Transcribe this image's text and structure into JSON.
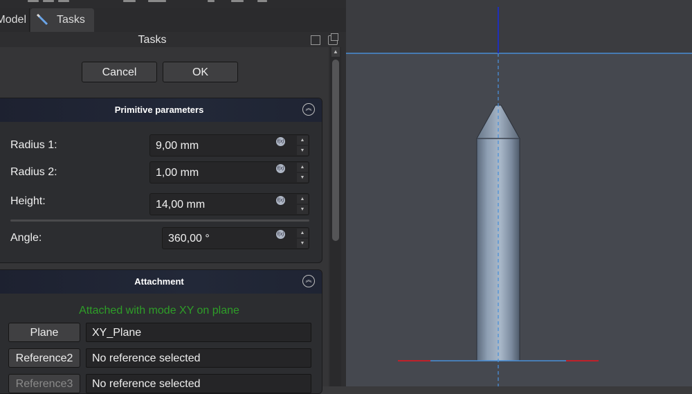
{
  "tabs": [
    {
      "label": "Model"
    },
    {
      "label": "Tasks",
      "icon": "pencil-icon"
    }
  ],
  "panel": {
    "title": "Tasks",
    "controls": [
      "float-panel-icon",
      "undock-panel-icon"
    ]
  },
  "dialog": {
    "cancel_label": "Cancel",
    "ok_label": "OK"
  },
  "primitive": {
    "title": "Primitive parameters",
    "fields": [
      {
        "label": "Radius 1:",
        "value": "9,00 mm"
      },
      {
        "label": "Radius 2:",
        "value": "1,00 mm"
      },
      {
        "label": "Height:",
        "value": "14,00 mm"
      },
      {
        "label": "Angle:",
        "value": "360,00 °"
      }
    ],
    "fx_label": "f(x)"
  },
  "attachment": {
    "title": "Attachment",
    "status": "Attached with mode XY on plane",
    "status_color": "#2e9e28",
    "refs": [
      {
        "button": "Plane",
        "value": "XY_Plane"
      },
      {
        "button": "Reference2",
        "value": "No reference selected"
      },
      {
        "button": "Reference3",
        "value": "No reference selected"
      }
    ]
  },
  "viewport": {
    "axis_color": "#1f2fb8",
    "plane_line_color": "#4a90d9",
    "x_axis_color": "#c0202a"
  }
}
